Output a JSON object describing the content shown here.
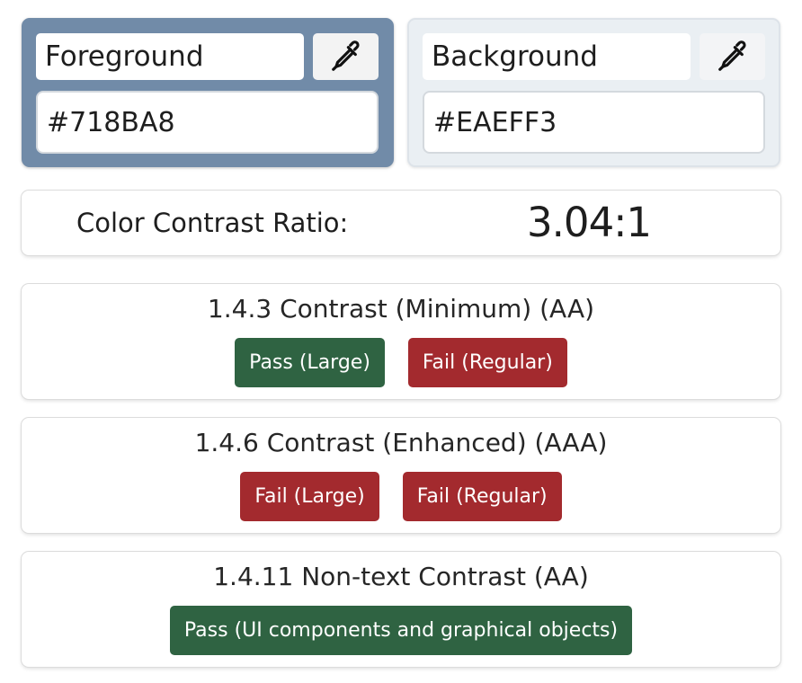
{
  "foreground": {
    "label": "Foreground",
    "value": "#718BA8",
    "color": "#718ba8",
    "picker_icon": "eyedropper-icon"
  },
  "background": {
    "label": "Background",
    "value": "#EAEFF3",
    "color": "#eaeff3",
    "picker_icon": "eyedropper-icon"
  },
  "ratio": {
    "label": "Color Contrast Ratio:",
    "value": "3.04:1"
  },
  "criteria": [
    {
      "title": "1.4.3 Contrast (Minimum) (AA)",
      "results": [
        {
          "label": "Pass (Large)",
          "status": "pass"
        },
        {
          "label": "Fail (Regular)",
          "status": "fail"
        }
      ]
    },
    {
      "title": "1.4.6 Contrast (Enhanced) (AAA)",
      "results": [
        {
          "label": "Fail (Large)",
          "status": "fail"
        },
        {
          "label": "Fail (Regular)",
          "status": "fail"
        }
      ]
    },
    {
      "title": "1.4.11 Non-text Contrast (AA)",
      "results": [
        {
          "label": "Pass (UI components and graphical objects)",
          "status": "pass"
        }
      ]
    }
  ],
  "colors": {
    "pass": "#2f6342",
    "fail": "#a32a2e"
  }
}
